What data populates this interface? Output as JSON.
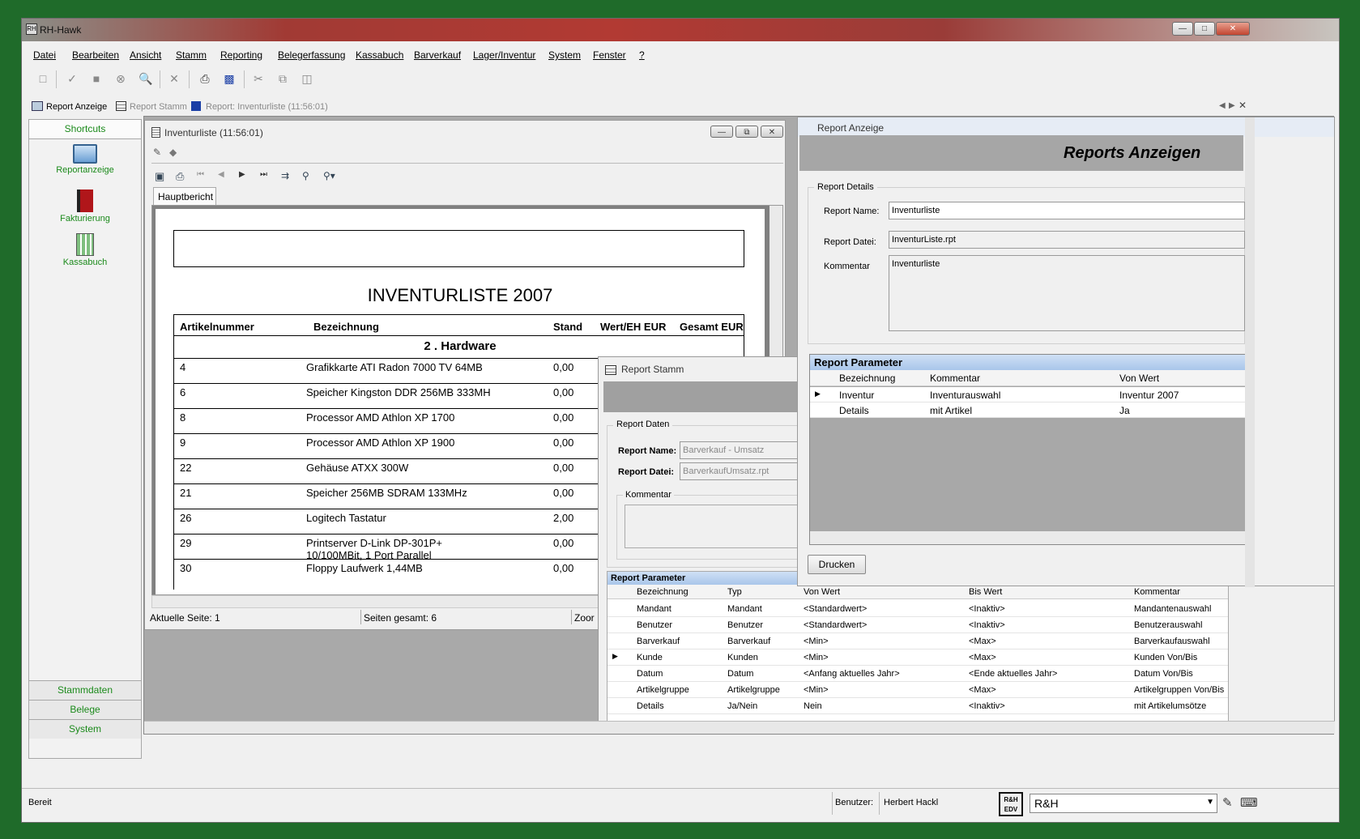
{
  "app": {
    "title": "RH-Hawk",
    "logo": "RH"
  },
  "menu": [
    "Datei",
    "Bearbeiten",
    "Ansicht",
    "Stamm",
    "Reporting",
    "Belegerfassung",
    "Kassabuch",
    "Barverkauf",
    "Lager/Inventur",
    "System",
    "Fenster",
    "?"
  ],
  "tabs": [
    "Report Anzeige",
    "Report Stamm",
    "Report: Inventurliste (11:56:01)"
  ],
  "sidebar": {
    "header": "Shortcuts",
    "items": [
      "Reportanzeige",
      "Fakturierung",
      "Kassabuch"
    ],
    "bottom": [
      "Stammdaten",
      "Belege",
      "System"
    ]
  },
  "report_window": {
    "title": "Inventurliste (11:56:01)",
    "subtab": "Hauptbericht",
    "report_title": "INVENTURLISTE 2007",
    "columns": [
      "Artikelnummer",
      "Bezeichnung",
      "Stand",
      "Wert/EH EUR",
      "Gesamt EUR"
    ],
    "group": "2  . Hardware",
    "rows": [
      {
        "nr": "4",
        "bez": "Grafikkarte ATI Radon 7000 TV 64MB",
        "stand": "0,00"
      },
      {
        "nr": "6",
        "bez": "Speicher Kingston DDR 256MB 333MH",
        "stand": "0,00"
      },
      {
        "nr": "8",
        "bez": "Processor AMD Athlon XP 1700",
        "stand": "0,00"
      },
      {
        "nr": "9",
        "bez": "Processor AMD Athlon XP 1900",
        "stand": "0,00"
      },
      {
        "nr": "22",
        "bez": "Gehäuse ATXX 300W",
        "stand": "0,00"
      },
      {
        "nr": "21",
        "bez": "Speicher 256MB SDRAM 133MHz",
        "stand": "0,00"
      },
      {
        "nr": "26",
        "bez": "Logitech Tastatur",
        "stand": "2,00"
      },
      {
        "nr": "29",
        "bez": "Printserver D-Link DP-301P+\n10/100MBit, 1 Port Parallel",
        "stand": "0,00"
      },
      {
        "nr": "30",
        "bez": "Floppy Laufwerk 1,44MB",
        "stand": "0,00"
      }
    ],
    "status_page": "Aktuelle Seite: 1",
    "status_total": "Seiten gesamt: 6",
    "status_zoom": "Zoor"
  },
  "report_stamm": {
    "title": "Report Stamm",
    "group": "Report Daten",
    "name_label": "Report Name:",
    "name_value": "Barverkauf - Umsatz",
    "file_label": "Report Datei:",
    "file_value": "BarverkaufUmsatz.rpt",
    "comment_label": "Kommentar",
    "param_title": "Report Parameter",
    "param_columns": [
      "Bezeichnung",
      "Typ",
      "Von Wert",
      "Bis Wert",
      "Kommentar"
    ],
    "params": [
      [
        "Mandant",
        "Mandant",
        "<Standardwert>",
        "<Inaktiv>",
        "Mandantenauswahl"
      ],
      [
        "Benutzer",
        "Benutzer",
        "<Standardwert>",
        "<Inaktiv>",
        "Benutzerauswahl"
      ],
      [
        "Barverkauf",
        "Barverkauf",
        "<Min>",
        "<Max>",
        "Barverkaufauswahl"
      ],
      [
        "Kunde",
        "Kunden",
        "<Min>",
        "<Max>",
        "Kunden Von/Bis"
      ],
      [
        "Datum",
        "Datum",
        "<Anfang aktuelles Jahr>",
        "<Ende aktuelles Jahr>",
        "Datum Von/Bis"
      ],
      [
        "Artikelgruppe",
        "Artikelgruppe",
        "<Min>",
        "<Max>",
        "Artikelgruppen Von/Bis"
      ],
      [
        "Details",
        "Ja/Nein",
        "Nein",
        "<Inaktiv>",
        "mit Artikelumsötze"
      ]
    ]
  },
  "report_anzeige": {
    "title": "Report Anzeige",
    "heading": "Reports Anzeigen",
    "group": "Report Details",
    "name_label": "Report Name:",
    "name_value": "Inventurliste",
    "file_label": "Report Datei:",
    "file_value": "InventurListe.rpt",
    "comment_label": "Kommentar",
    "comment_value": "Inventurliste",
    "param_title": "Report Parameter",
    "param_columns": [
      "Bezeichnung",
      "Kommentar",
      "Von Wert"
    ],
    "params": [
      [
        "Inventur",
        "Inventurauswahl",
        "Inventur 2007"
      ],
      [
        "Details",
        "mit Artikel",
        "Ja"
      ]
    ],
    "print_button": "Drucken"
  },
  "status": {
    "ready": "Bereit",
    "user_label": "Benutzer:",
    "user": "Herbert Hackl",
    "logo": "R&H EDV",
    "company": "R&H"
  }
}
